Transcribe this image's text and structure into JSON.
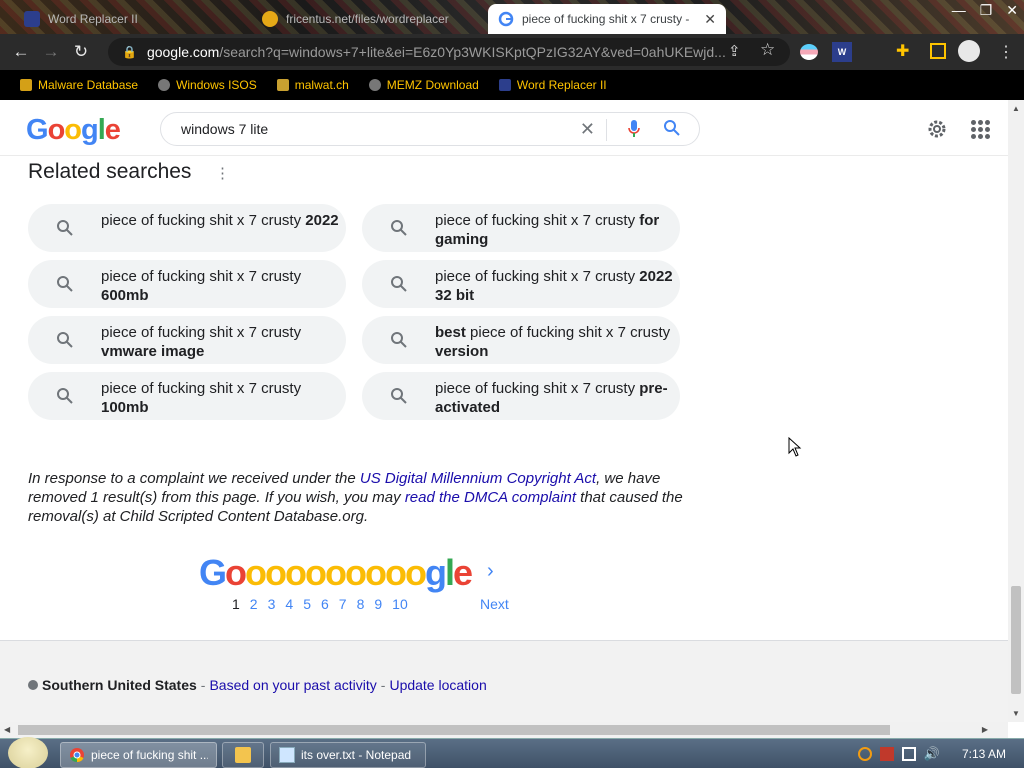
{
  "browser": {
    "tabs": [
      {
        "title": "Word Replacer II",
        "active": false
      },
      {
        "title": "fricentus.net/files/wordreplacer",
        "active": false
      },
      {
        "title": "piece of fucking shit x 7 crusty -",
        "active": true
      }
    ],
    "address": {
      "host": "google.com",
      "path": "/search?q=windows+7+lite&ei=E6z0Yp3WKISKptQPzIG32AY&ved=0ahUKEwjd..."
    },
    "bookmarks": [
      {
        "label": "Malware Database"
      },
      {
        "label": "Windows ISOS"
      },
      {
        "label": "malwat.ch"
      },
      {
        "label": "MEMZ Download"
      },
      {
        "label": "Word Replacer II"
      }
    ]
  },
  "google": {
    "logo": [
      "G",
      "o",
      "o",
      "g",
      "l",
      "e"
    ],
    "query": "windows 7 lite",
    "related_title": "Related searches",
    "related": [
      {
        "prefix": "",
        "main": "piece of fucking shit x 7 crusty",
        "bold": "2022"
      },
      {
        "prefix": "",
        "main": "piece of fucking shit x 7 crusty",
        "bold": "for gaming"
      },
      {
        "prefix": "",
        "main": "piece of fucking shit x 7 crusty",
        "bold": "600mb"
      },
      {
        "prefix": "",
        "main": "piece of fucking shit x 7 crusty",
        "bold": "2022 32 bit"
      },
      {
        "prefix": "",
        "main": "piece of fucking shit x 7 crusty",
        "bold": "vmware image"
      },
      {
        "prefix": "best",
        "main": "piece of fucking shit x 7 crusty",
        "bold": "version"
      },
      {
        "prefix": "",
        "main": "piece of fucking shit x 7 crusty",
        "bold": "100mb"
      },
      {
        "prefix": "",
        "main": "piece of fucking shit x 7 crusty",
        "bold": "pre-activated"
      }
    ],
    "dmca": {
      "before": "In response to a complaint we received under the ",
      "link1": "US Digital Millennium Copyright Act",
      "middle": ", we have removed 1 result(s) from this page. If you wish, you may ",
      "link2": "read the DMCA complaint",
      "after": " that caused the removal(s) at Child Scripted Content Database.org."
    },
    "pager": {
      "pages": [
        "1",
        "2",
        "3",
        "4",
        "5",
        "6",
        "7",
        "8",
        "9",
        "10"
      ],
      "current": "1",
      "next": "Next"
    },
    "footer": {
      "location": "Southern United States",
      "sep1": " - ",
      "based": "Based on your past activity",
      "sep2": " - ",
      "update": "Update location"
    }
  },
  "taskbar": {
    "items": [
      {
        "label": "piece of fucking shit ...",
        "active": true
      },
      {
        "label": "",
        "active": false
      },
      {
        "label": "its over.txt - Notepad",
        "active": false
      }
    ],
    "time": "7:13 AM"
  },
  "colors": {
    "google_blue": "#4285f4",
    "google_red": "#ea4335",
    "google_yellow": "#fbbc05",
    "google_green": "#34a853",
    "link": "#1a0dab"
  }
}
